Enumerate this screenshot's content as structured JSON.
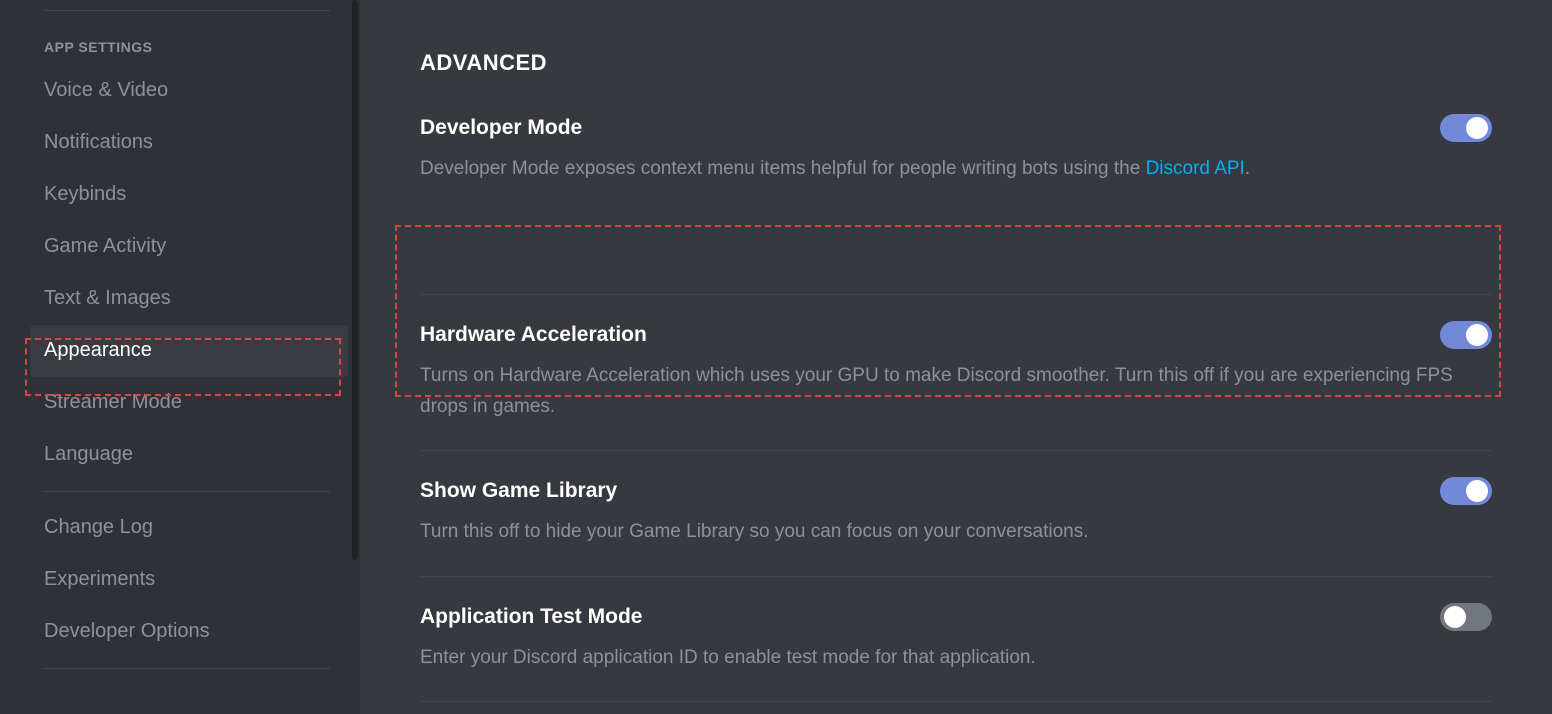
{
  "sidebar": {
    "header": "APP SETTINGS",
    "items": [
      {
        "label": "Voice & Video",
        "active": false
      },
      {
        "label": "Notifications",
        "active": false
      },
      {
        "label": "Keybinds",
        "active": false
      },
      {
        "label": "Game Activity",
        "active": false
      },
      {
        "label": "Text & Images",
        "active": false
      },
      {
        "label": "Appearance",
        "active": true
      },
      {
        "label": "Streamer Mode",
        "active": false
      },
      {
        "label": "Language",
        "active": false
      }
    ],
    "extra_items": [
      {
        "label": "Change Log"
      },
      {
        "label": "Experiments"
      },
      {
        "label": "Developer Options"
      }
    ]
  },
  "content": {
    "section_title": "ADVANCED",
    "settings": [
      {
        "title": "Developer Mode",
        "description_pre": "Developer Mode exposes context menu items helpful for people writing bots using the ",
        "link_text": "Discord API",
        "description_post": ".",
        "toggle_on": true
      },
      {
        "title": "Hardware Acceleration",
        "description": "Turns on Hardware Acceleration which uses your GPU to make Discord smoother. Turn this off if you are experiencing FPS drops in games.",
        "toggle_on": true
      },
      {
        "title": "Show Game Library",
        "description": "Turn this off to hide your Game Library so you can focus on your conversations.",
        "toggle_on": true
      },
      {
        "title": "Application Test Mode",
        "description": "Enter your Discord application ID to enable test mode for that application.",
        "toggle_on": false
      }
    ]
  }
}
